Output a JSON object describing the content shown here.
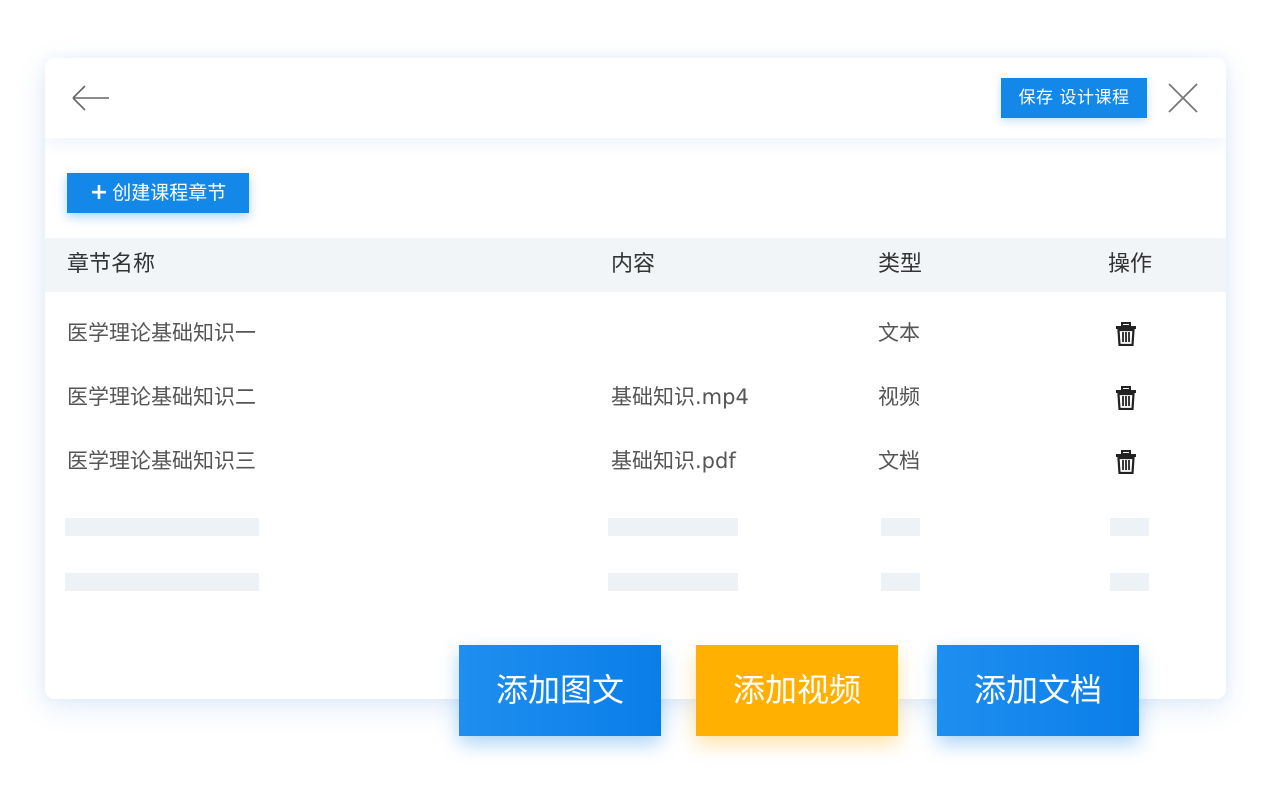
{
  "header": {
    "save_label": "保存 设计课程"
  },
  "toolbar": {
    "create_label": "创建课程章节"
  },
  "table": {
    "columns": [
      "章节名称",
      "内容",
      "类型",
      "操作"
    ],
    "rows": [
      {
        "name": "医学理论基础知识一",
        "content": "",
        "type": "文本"
      },
      {
        "name": "医学理论基础知识二",
        "content": "基础知识.mp4",
        "type": "视频"
      },
      {
        "name": "医学理论基础知识三",
        "content": "基础知识.pdf",
        "type": "文档"
      }
    ]
  },
  "actions": {
    "add_graphic": "添加图文",
    "add_video": "添加视频",
    "add_document": "添加文档"
  },
  "colors": {
    "primary": "#1488e8",
    "accent_orange": "#ffb000",
    "header_bg": "#f1f5f8",
    "placeholder": "#edf2f6"
  },
  "icons": [
    "back-arrow-icon",
    "close-icon",
    "plus-icon",
    "trash-icon"
  ]
}
